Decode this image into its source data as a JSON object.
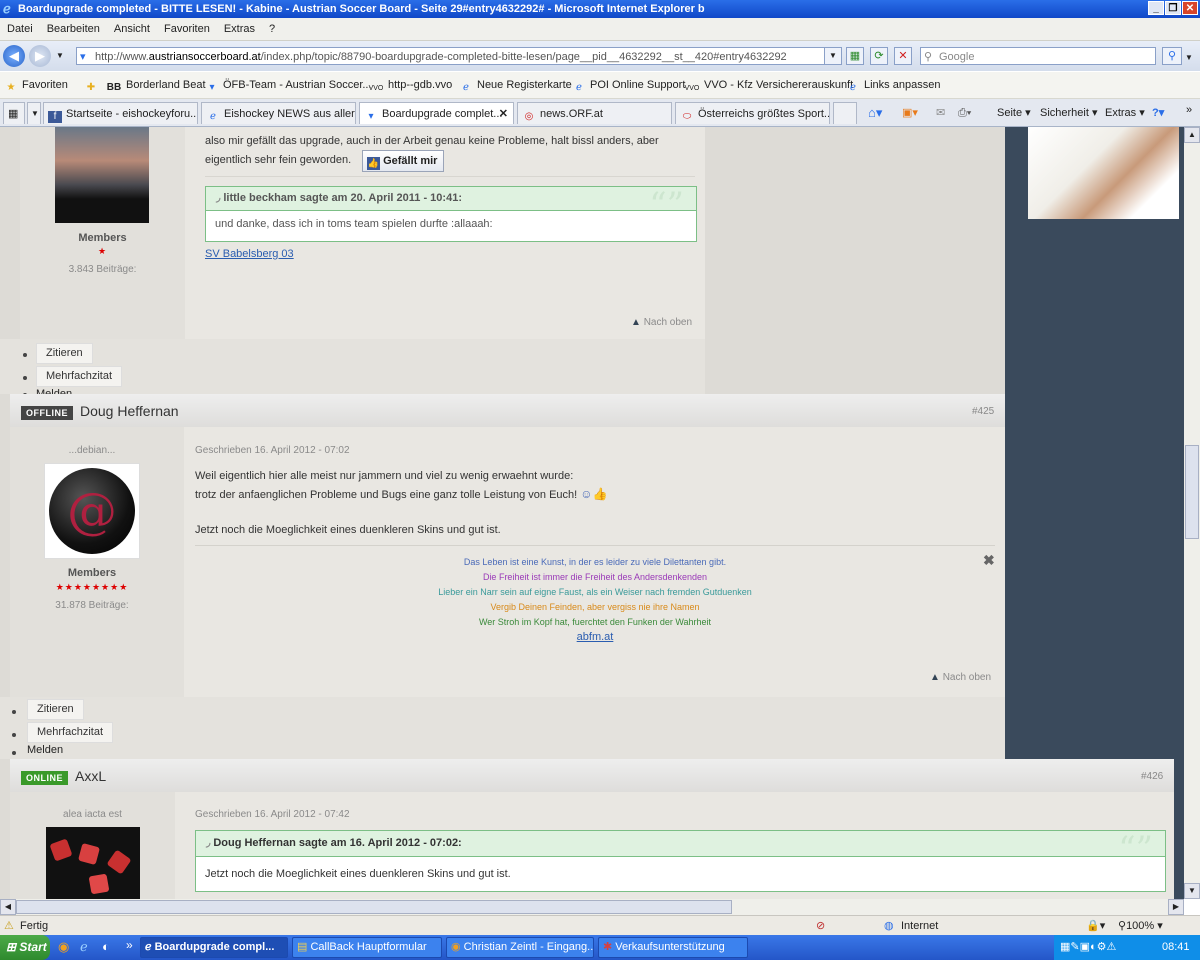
{
  "window": {
    "title": "Boardupgrade completed - BITTE LESEN! - Kabine - Austrian Soccer Board - Seite 29#entry4632292# - Microsoft Internet Explorer b"
  },
  "menu": [
    "Datei",
    "Bearbeiten",
    "Ansicht",
    "Favoriten",
    "Extras",
    "?"
  ],
  "address": {
    "prefix": "http://www.",
    "domain": "austriansoccerboard.at",
    "rest": "/index.php/topic/88790-boardupgrade-completed-bitte-lesen/page__pid__4632292__st__420#entry4632292"
  },
  "search": {
    "placeholder": "Google"
  },
  "favorites": {
    "label": "Favoriten",
    "items": [
      "Borderland Beat",
      "ÖFB-Team - Austrian Soccer...",
      "http--gdb.vvo",
      "Neue Registerkarte",
      "POI Online Support",
      "VVO - Kfz Versichererauskunft",
      "Links anpassen"
    ]
  },
  "tabs": [
    "Startseite - eishockeyforu...",
    "Eishockey NEWS aus aller ...",
    "Boardupgrade complet...",
    "news.ORF.at",
    "Österreichs größtes Sport..."
  ],
  "commands": {
    "seite": "Seite",
    "sicherheit": "Sicherheit",
    "extras": "Extras"
  },
  "post1": {
    "role": "Members",
    "posts": "3.843 Beiträge:",
    "line1": "also mir gefällt das upgrade, auch in der Arbeit genau keine Probleme, halt bissl anders, aber",
    "line2": "eigentlich sehr fein geworden.",
    "like": "Gefällt mir",
    "quote_header": "little beckham sagte am 20. April 2011 - 10:41:",
    "quote_body": "und danke, dass ich in toms team spielen durfte :allaaah:",
    "sig_link": "SV Babelsberg 03",
    "top": "Nach oben",
    "actions": [
      "Zitieren",
      "Mehrfachzitat",
      "Melden"
    ]
  },
  "post2": {
    "status": "OFFLINE",
    "user": "Doug Heffernan",
    "num": "#425",
    "tagline": "...debian...",
    "role": "Members",
    "stars": "★★★★★★★★",
    "posts": "31.878 Beiträge:",
    "date": "Geschrieben 16. April 2012 - 07:02",
    "lines": [
      "Weil eigentlich hier alle meist nur jammern und viel zu wenig erwaehnt wurde:",
      "trotz der anfaenglichen Probleme und Bugs eine ganz tolle Leistung von Euch!",
      "Jetzt noch die Moeglichkeit eines duenkleren Skins und gut ist."
    ],
    "sig": [
      "Das Leben ist eine Kunst, in der es leider zu viele Dilettanten gibt.",
      "Die Freiheit ist immer die Freiheit des Andersdenkenden",
      "Lieber ein Narr sein auf eigne Faust, als ein Weiser nach fremden Gutduenken",
      "Vergib Deinen Feinden, aber vergiss nie ihre Namen",
      "Wer Stroh im Kopf hat, fuerchtet den Funken der Wahrheit"
    ],
    "sig_link": "abfm.at",
    "top": "Nach oben",
    "actions": [
      "Zitieren",
      "Mehrfachzitat",
      "Melden"
    ]
  },
  "post3": {
    "status": "ONLINE",
    "user": "AxxL",
    "num": "#426",
    "tagline": "alea iacta est",
    "date": "Geschrieben 16. April 2012 - 07:42",
    "quote_header": "Doug Heffernan sagte am 16. April 2012 - 07:02:",
    "quote_body": "Jetzt noch die Moeglichkeit eines duenkleren Skins und gut ist."
  },
  "status": {
    "text": "Fertig",
    "zone": "Internet",
    "zoom": "100%"
  },
  "taskbar": {
    "start": "Start",
    "tasks": [
      "Boardupgrade compl...",
      "CallBack Hauptformular",
      "Christian Zeintl - Eingang...",
      "Verkaufsunterstützung"
    ],
    "time": "08:41"
  },
  "colors": {
    "sig1": "#4a6ab8",
    "sig2": "#9a3ab8",
    "sig3": "#3a9a9a",
    "sig4": "#d88a1a",
    "sig5": "#3a8a3a"
  }
}
